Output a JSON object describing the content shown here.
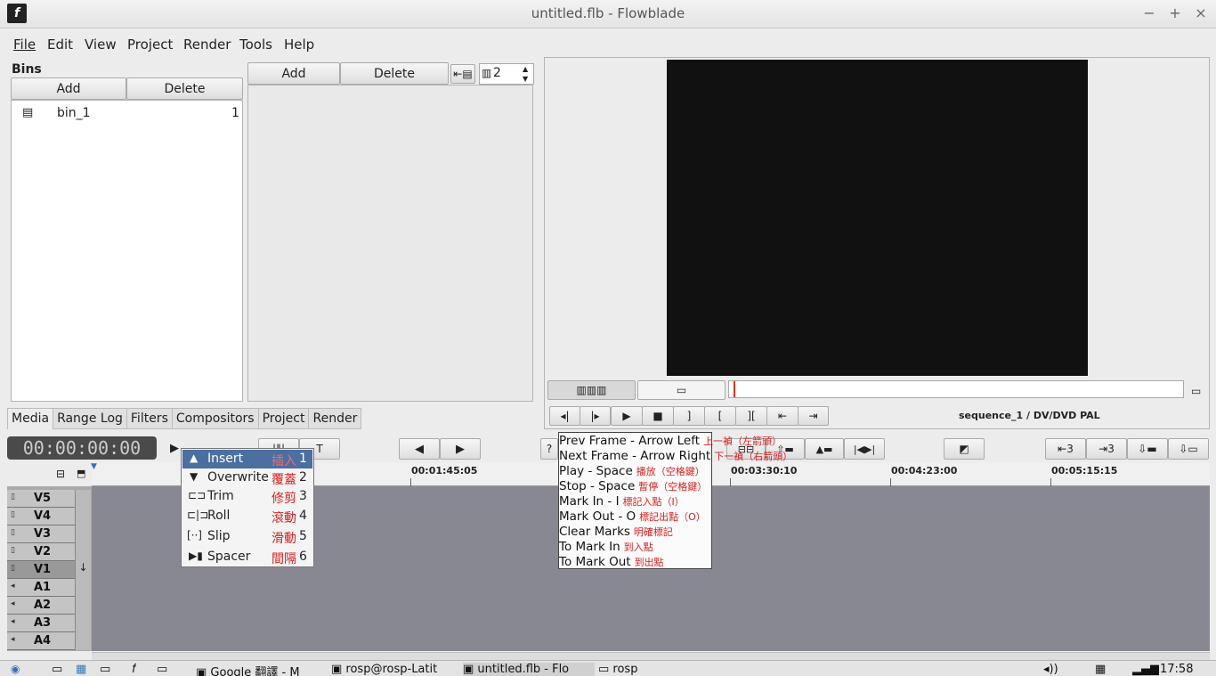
{
  "window": {
    "title": "untitled.flb - Flowblade",
    "controls": {
      "minimize": "−",
      "maximize": "+",
      "close": "×"
    }
  },
  "menubar": [
    "File",
    "Edit",
    "View",
    "Project",
    "Render",
    "Tools",
    "Help"
  ],
  "bins": {
    "heading": "Bins",
    "add_label": "Add",
    "delete_label": "Delete",
    "items": [
      {
        "name": "bin_1",
        "count": "1"
      }
    ]
  },
  "media": {
    "add_label": "Add",
    "delete_label": "Delete",
    "columns_value": "2"
  },
  "notebook_tabs": [
    "Media",
    "Range Log",
    "Filters",
    "Compositors",
    "Project",
    "Render"
  ],
  "monitor": {
    "sequence_info": "sequence_1 / DV/DVD PAL",
    "background": "#111111"
  },
  "timecode": "00:00:00:00",
  "edit_mode_menu": [
    {
      "label": "Insert",
      "zh": "插入",
      "key": "1",
      "icon": "arrow-pointer-icon"
    },
    {
      "label": "Overwrite",
      "zh": "覆蓋",
      "key": "2",
      "icon": "overwrite-down-icon"
    },
    {
      "label": "Trim",
      "zh": "修剪",
      "key": "3",
      "icon": "trim-icon"
    },
    {
      "label": "Roll",
      "zh": "滾動",
      "key": "4",
      "icon": "roll-icon"
    },
    {
      "label": "Slip",
      "zh": "滑動",
      "key": "5",
      "icon": "slip-icon"
    },
    {
      "label": "Spacer",
      "zh": "間隔",
      "key": "6",
      "icon": "spacer-icon"
    }
  ],
  "shortcut_tooltip": [
    {
      "en": "Prev Frame - Arrow Left",
      "zh": "上一禎（左箭頭）"
    },
    {
      "en": "Next Frame - Arrow Right",
      "zh": "下一禎（右箭頭）"
    },
    {
      "en": "Play - Space",
      "zh": "播放（空格鍵）"
    },
    {
      "en": "Stop - Space",
      "zh": "暫停（空格鍵）"
    },
    {
      "en": "Mark In - I",
      "zh": "標記入點（I）"
    },
    {
      "en": "Mark Out - O",
      "zh": "標記出點（O）"
    },
    {
      "en": "Clear Marks",
      "zh": "明確標記"
    },
    {
      "en": "To Mark In",
      "zh": "到入點"
    },
    {
      "en": "To Mark Out",
      "zh": "到出點"
    }
  ],
  "timeline": {
    "ruler_labels": [
      "00:01:45:05",
      "00:03:30:10",
      "00:04:23:00",
      "00:05:15:15"
    ],
    "tracks": [
      "V5",
      "V4",
      "V3",
      "V2",
      "V1",
      "A1",
      "A2",
      "A3",
      "A4"
    ],
    "track_area_color": "#888892",
    "track_buttons": {
      "compress": "⊟",
      "lock": "🔒"
    }
  },
  "trim_buttons": {
    "a": "⇤3",
    "b": "⇥3"
  },
  "taskbar": {
    "tasks": [
      "Google 翻譯 - M",
      "rosp@rosp-Latit",
      "untitled.flb - Flo",
      "rosp"
    ],
    "clock": "17:58"
  }
}
